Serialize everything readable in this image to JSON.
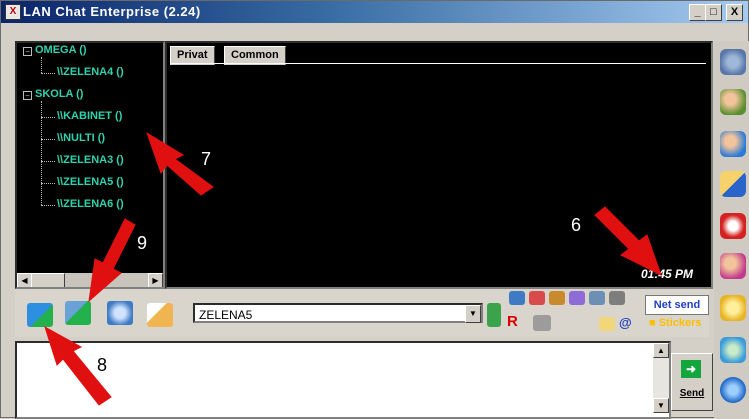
{
  "window": {
    "title": "LAN Chat Enterprise (2.24)",
    "app_icon": "X"
  },
  "titlebar_buttons": [
    "_",
    "□",
    "X"
  ],
  "tree": {
    "groups": [
      {
        "label": "OMEGA ()",
        "children": [
          "\\\\ZELENA4 ()"
        ]
      },
      {
        "label": "SKOLA ()",
        "children": [
          "\\\\KABINET ()",
          "\\\\NULTI ()",
          "\\\\ZELENA3 ()",
          "\\\\ZELENA5 ()",
          "\\\\ZELENA6 ()"
        ]
      }
    ]
  },
  "chat": {
    "tabs": [
      "Privat",
      "Common"
    ],
    "active_tab": "Privat",
    "timestamp": "01:45 PM"
  },
  "toolbar": {
    "recipient": "ZELENA5",
    "net_send_label": "Net send",
    "stickers_label": "Stickers",
    "red_r": "R"
  },
  "send_label": "Send",
  "annotations": [
    "6",
    "7",
    "8",
    "9"
  ],
  "colors": {
    "tree_text": "#2fd3ad",
    "arrow": "#e11010"
  }
}
